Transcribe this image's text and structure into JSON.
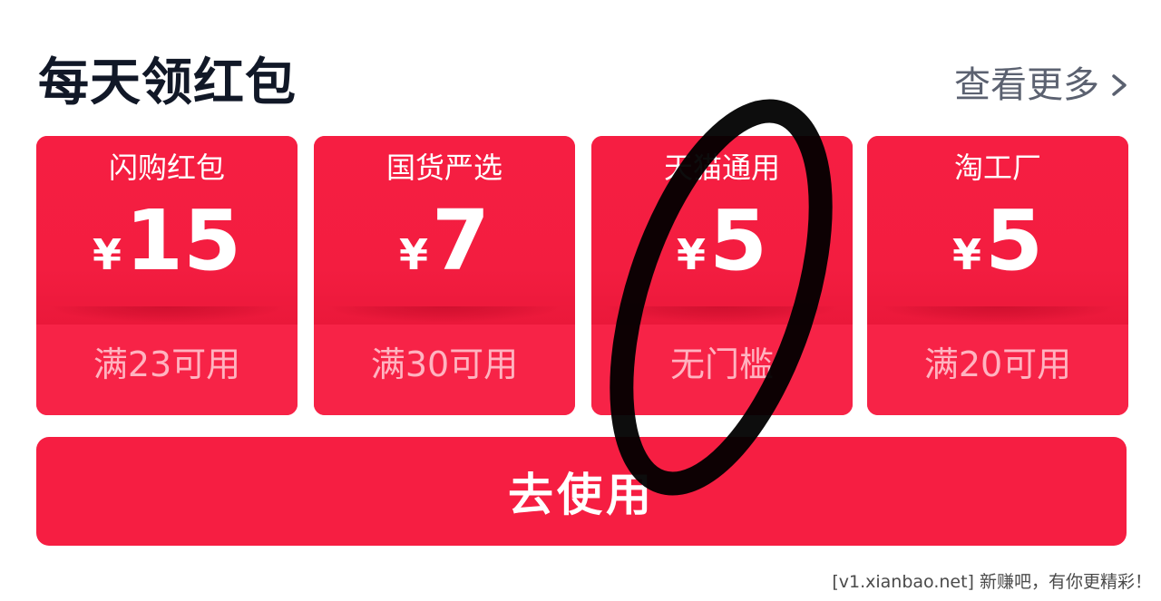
{
  "header": {
    "title": "每天领红包",
    "more_label": "查看更多",
    "more_icon": "chevron-right-icon"
  },
  "cards": [
    {
      "name": "闪购红包",
      "currency": "¥",
      "amount": "15",
      "condition": "满23可用"
    },
    {
      "name": "国货严选",
      "currency": "¥",
      "amount": "7",
      "condition": "满30可用"
    },
    {
      "name": "天猫通用",
      "currency": "¥",
      "amount": "5",
      "condition": "无门槛"
    },
    {
      "name": "淘工厂",
      "currency": "¥",
      "amount": "5",
      "condition": "满20可用"
    }
  ],
  "use_button": {
    "label": "去使用"
  },
  "watermark": "[v1.xianbao.net] 新赚吧，有你更精彩！",
  "colors": {
    "card_red": "#f61e42",
    "condition_text": "#ffb3c0",
    "title_text": "#111827",
    "more_text": "#5b6170",
    "marker_stroke": "#000000"
  }
}
